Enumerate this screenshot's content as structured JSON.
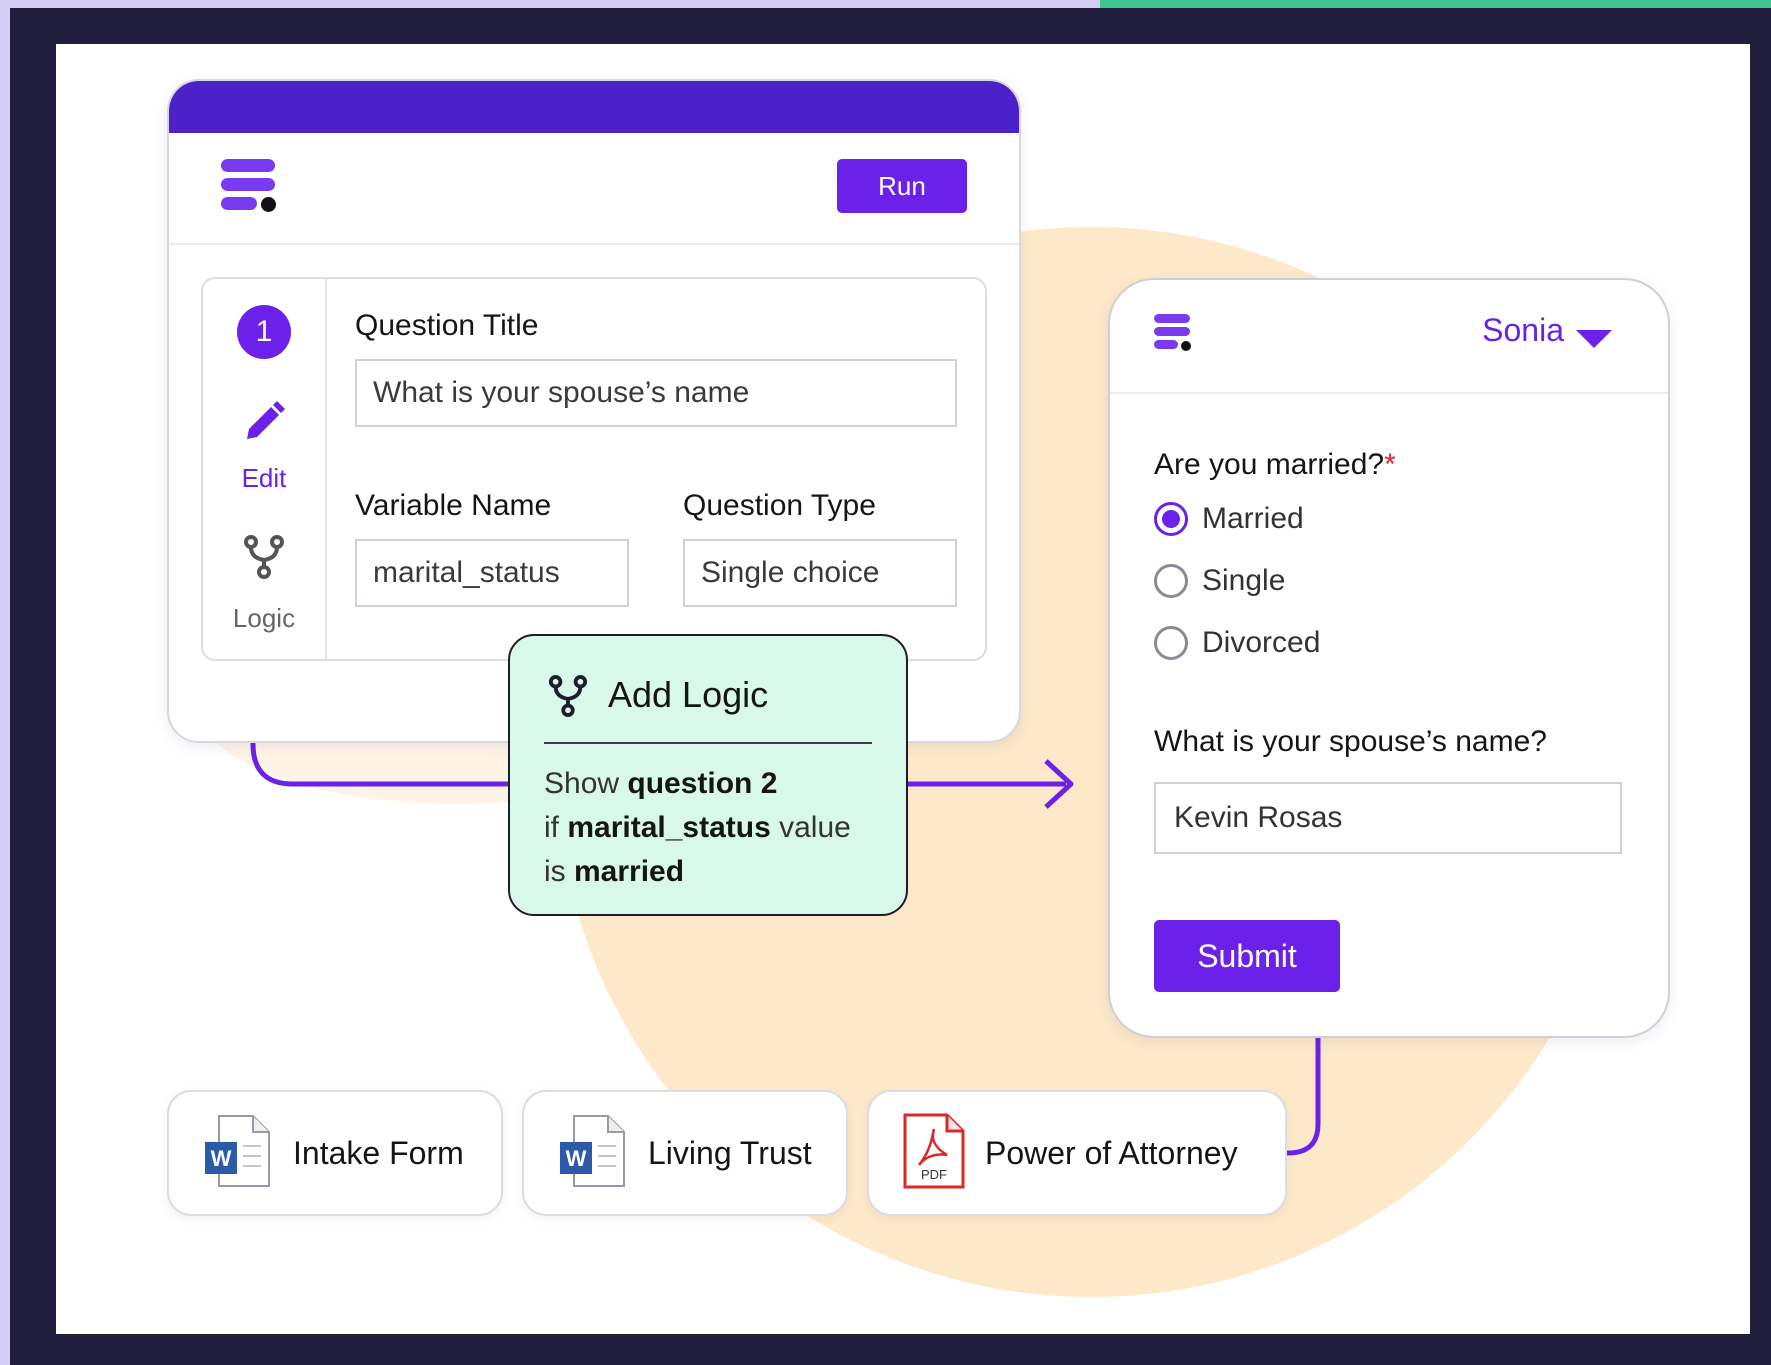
{
  "editor": {
    "run_label": "Run",
    "step_number": "1",
    "edit_label": "Edit",
    "logic_label": "Logic",
    "question_title_label": "Question Title",
    "question_title_value": "What is your spouse’s name",
    "variable_name_label": "Variable Name",
    "variable_name_value": "marital_status",
    "question_type_label": "Question Type",
    "question_type_value": "Single choice"
  },
  "logic": {
    "title": "Add Logic",
    "line1_prefix": "Show ",
    "line1_bold": "question 2",
    "line2_prefix": "if ",
    "line2_bold": "marital_status",
    "line2_suffix": " value",
    "line3_prefix": "is ",
    "line3_bold": "married"
  },
  "form": {
    "user": "Sonia",
    "question1": "Are you married?",
    "required_mark": "*",
    "options": [
      {
        "label": "Married",
        "selected": true
      },
      {
        "label": "Single",
        "selected": false
      },
      {
        "label": "Divorced",
        "selected": false
      }
    ],
    "question2": "What is your spouse’s name?",
    "answer": "Kevin Rosas",
    "submit_label": "Submit"
  },
  "documents": [
    {
      "label": "Intake Form",
      "icon": "word-icon"
    },
    {
      "label": "Living Trust",
      "icon": "word-icon"
    },
    {
      "label": "Power of Attorney",
      "icon": "pdf-icon"
    }
  ],
  "icons": {
    "word_letter": "W",
    "pdf_letter": "PDF"
  },
  "colors": {
    "accent": "#6b21ea",
    "header_bar": "#4b22c9",
    "logic_bg": "#d8f8ea",
    "blob": "#fde9c9",
    "frame": "#211f3d",
    "required": "#d8262c",
    "word_blue": "#2b5aa8",
    "pdf_red": "#d62b26"
  }
}
